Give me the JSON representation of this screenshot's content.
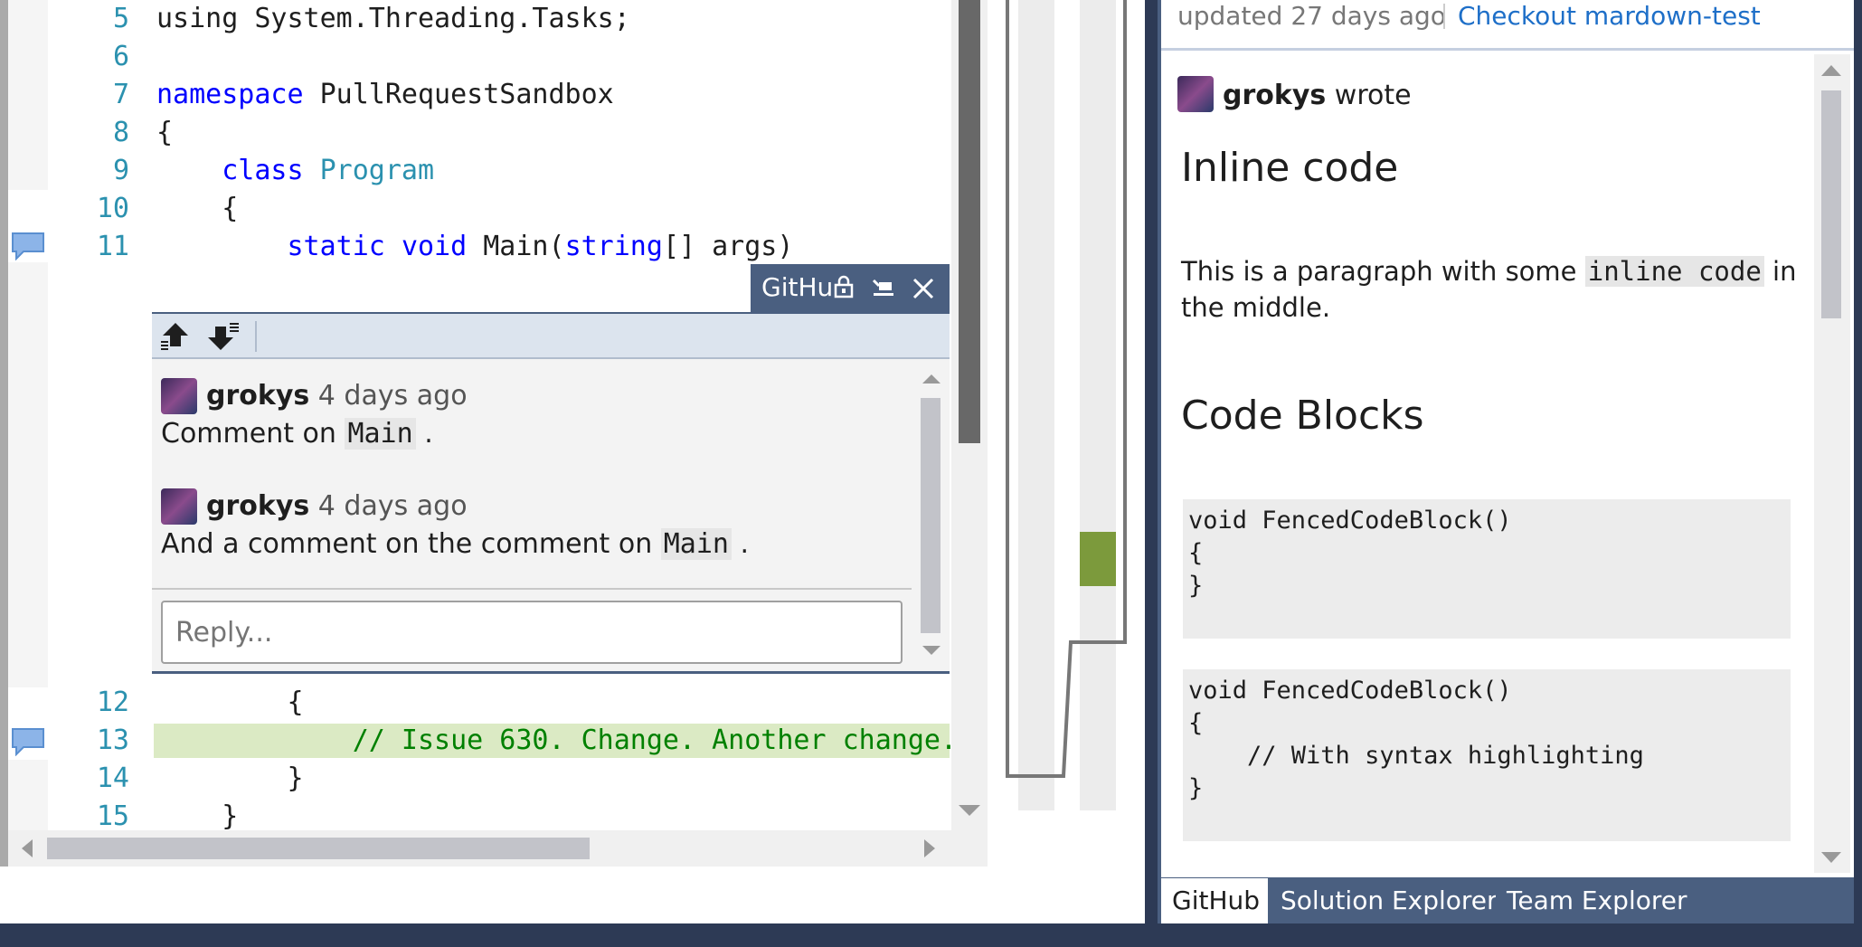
{
  "editor": {
    "lines": [
      {
        "num": "5",
        "parts": [
          {
            "t": "using System.Threading.Tasks;",
            "c": ""
          }
        ]
      },
      {
        "num": "6",
        "parts": []
      },
      {
        "num": "7",
        "parts": [
          {
            "t": "namespace",
            "c": "kw"
          },
          {
            "t": " PullRequestSandbox",
            "c": ""
          }
        ]
      },
      {
        "num": "8",
        "parts": [
          {
            "t": "{",
            "c": ""
          }
        ]
      },
      {
        "num": "9",
        "parts": [
          {
            "t": "    ",
            "c": ""
          },
          {
            "t": "class",
            "c": "kw"
          },
          {
            "t": " ",
            "c": ""
          },
          {
            "t": "Program",
            "c": "ty"
          }
        ]
      },
      {
        "num": "10",
        "parts": [
          {
            "t": "    {",
            "c": ""
          }
        ]
      },
      {
        "num": "11",
        "parts": [
          {
            "t": "        ",
            "c": ""
          },
          {
            "t": "static",
            "c": "kw"
          },
          {
            "t": " ",
            "c": ""
          },
          {
            "t": "void",
            "c": "kw"
          },
          {
            "t": " Main(",
            "c": ""
          },
          {
            "t": "string",
            "c": "kw"
          },
          {
            "t": "[] args)",
            "c": ""
          }
        ]
      },
      {
        "num": "12",
        "parts": [
          {
            "t": "        {",
            "c": ""
          }
        ]
      },
      {
        "num": "13",
        "parts": [
          {
            "t": "            ",
            "c": ""
          },
          {
            "t": "// Issue 630. Change. Another change.",
            "c": "cm"
          }
        ]
      },
      {
        "num": "14",
        "parts": [
          {
            "t": "        }",
            "c": ""
          }
        ]
      },
      {
        "num": "15",
        "parts": [
          {
            "t": "    }",
            "c": ""
          }
        ]
      }
    ]
  },
  "peek": {
    "tab_label": "GitHu",
    "comments": [
      {
        "author": "grokys",
        "time": "4 days ago",
        "text_before": "Comment on ",
        "code": "Main",
        "text_after": " ."
      },
      {
        "author": "grokys",
        "time": "4 days ago",
        "text_before": "And a comment on the comment on ",
        "code": "Main",
        "text_after": " ."
      }
    ],
    "reply_placeholder": "Reply..."
  },
  "tool": {
    "header_updated": "updated 27 days ago",
    "header_link": "Checkout mardown-test",
    "author": "grokys",
    "wrote": " wrote",
    "heading1": "Inline code",
    "para_before": "This is a paragraph with some ",
    "para_code": "inline code",
    "para_after": " in the middle.",
    "heading2": "Code Blocks",
    "block1": "void FencedCodeBlock()\n{\n}",
    "block2": "void FencedCodeBlock()\n{\n    // With syntax highlighting\n}",
    "tabs": [
      "GitHub",
      "Solution Explorer",
      "Team Explorer"
    ]
  },
  "colors": {
    "frame": "#2d3a55",
    "accent": "#4a5f80",
    "link": "#1e6fc8",
    "diff_added": "#dbeac4",
    "diff_marker": "#7c9a3c"
  }
}
